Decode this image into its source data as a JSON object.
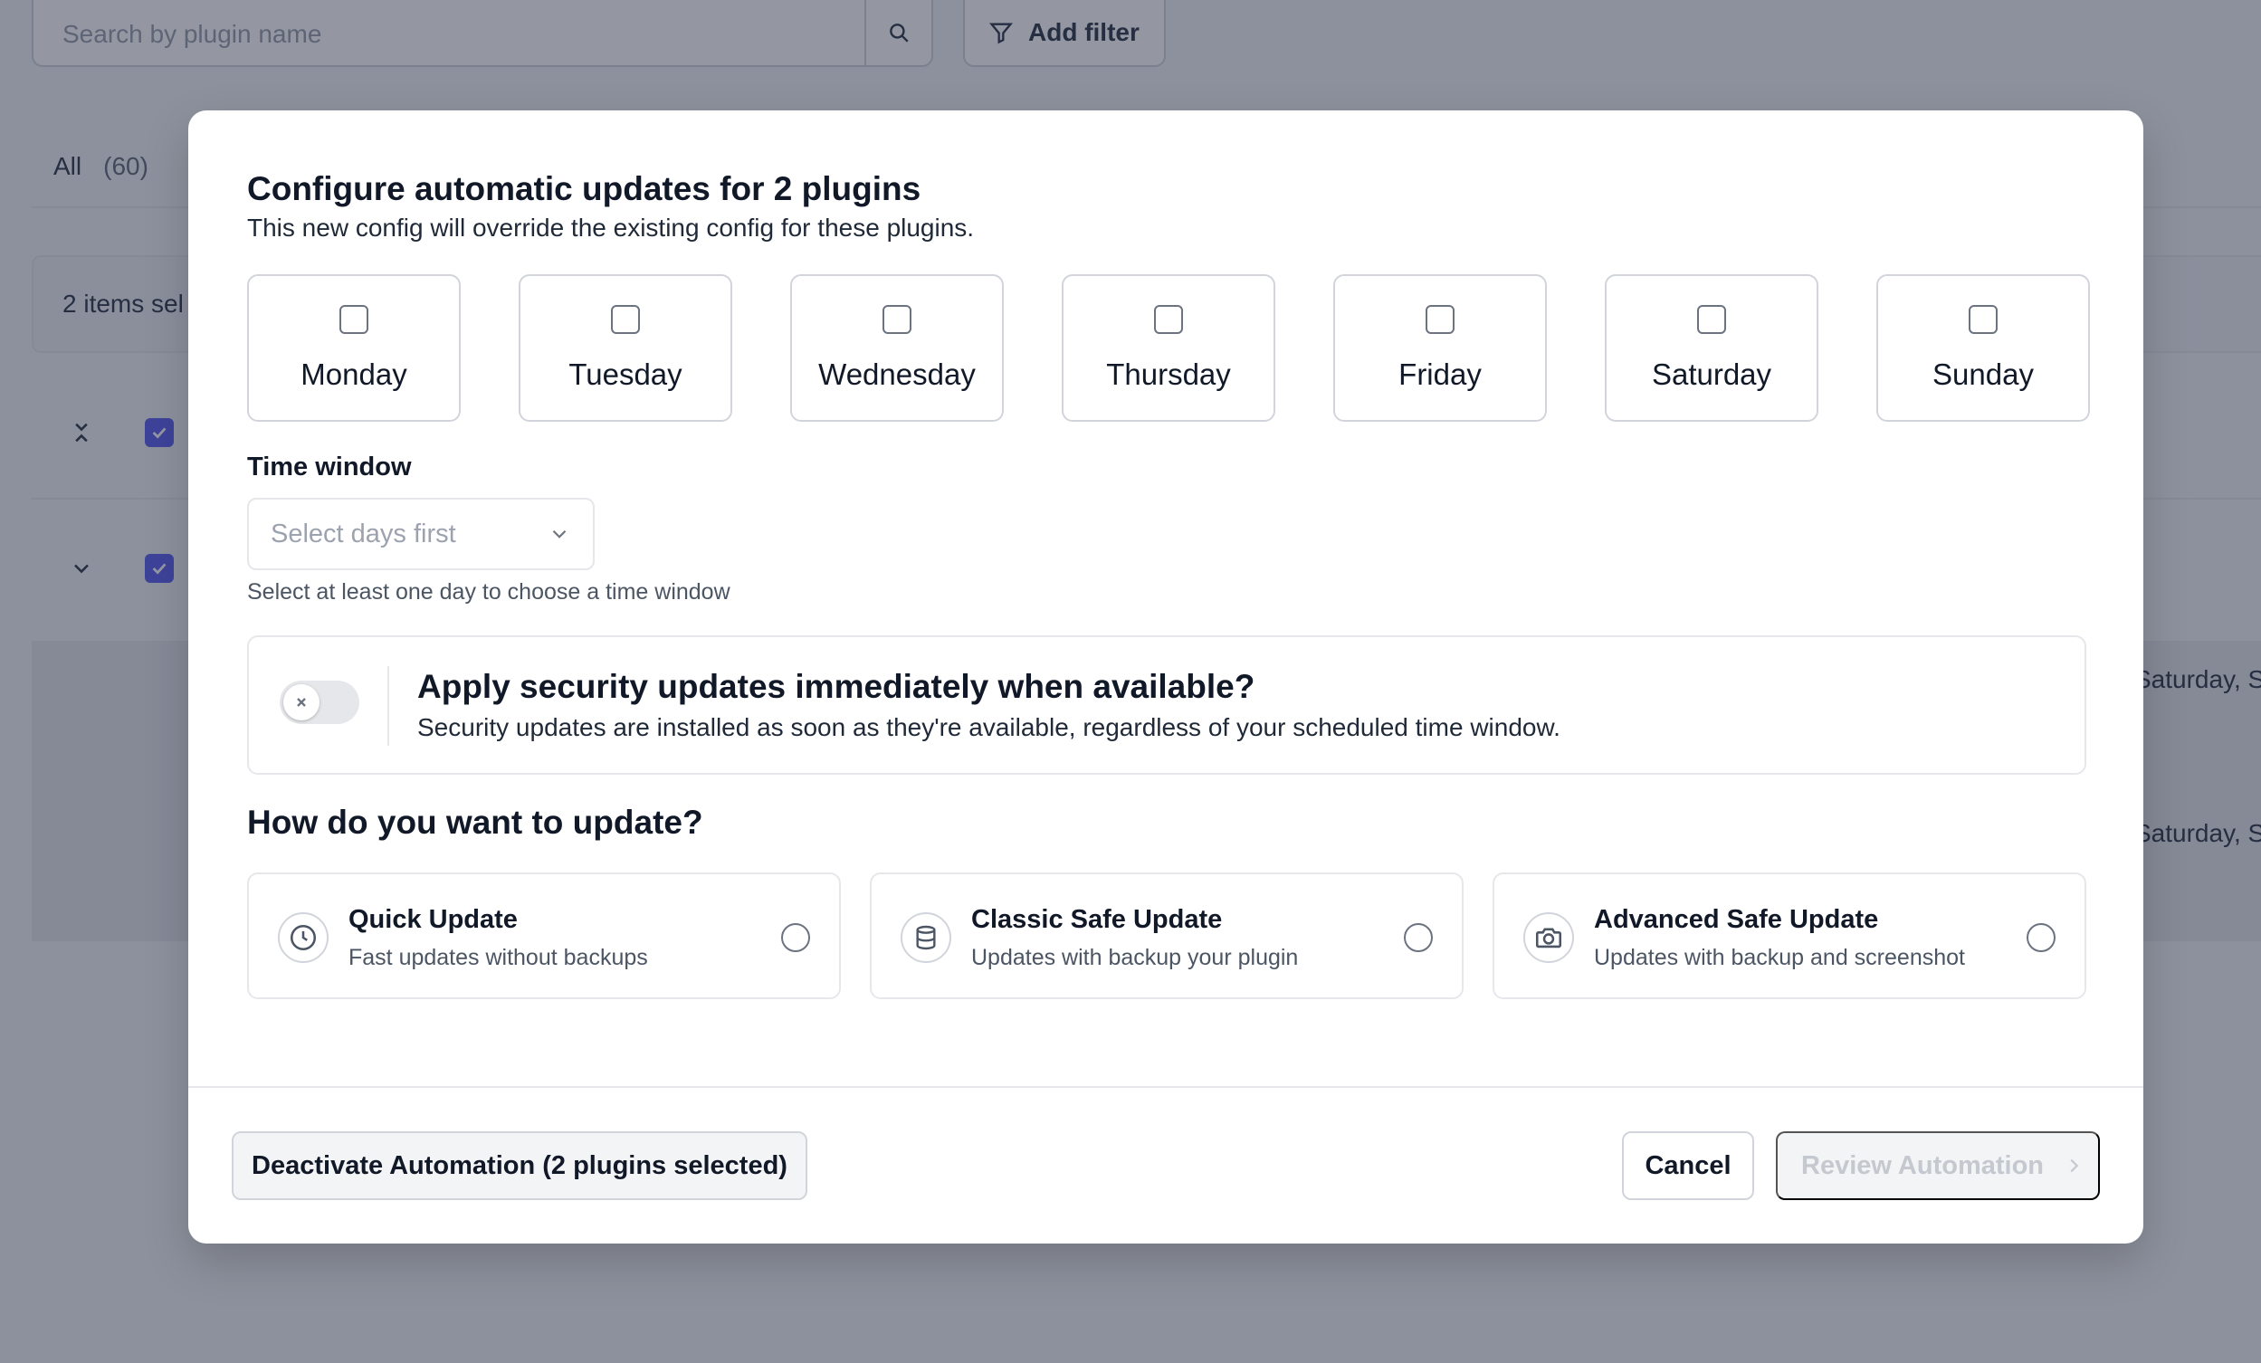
{
  "background": {
    "search_placeholder": "Search by plugin name",
    "add_filter_label": "Add filter",
    "tab_all_label": "All",
    "tab_all_count": "(60)",
    "selected_text": "2 items sel",
    "row_day_text": "Saturday, S"
  },
  "modal": {
    "title": "Configure automatic updates for 2 plugins",
    "subtitle": "This new config will override the existing config for these plugins.",
    "days": [
      "Monday",
      "Tuesday",
      "Wednesday",
      "Thursday",
      "Friday",
      "Saturday",
      "Sunday"
    ],
    "time_window": {
      "label": "Time window",
      "placeholder": "Select days first",
      "hint": "Select at least one day to choose a time window"
    },
    "security": {
      "title": "Apply security updates immediately when available?",
      "description": "Security updates are installed as soon as they're available, regardless of your scheduled time window.",
      "enabled": false
    },
    "how": {
      "title": "How do you want to update?",
      "options": [
        {
          "title": "Quick Update",
          "description": "Fast updates without backups",
          "icon": "clock-icon"
        },
        {
          "title": "Classic Safe Update",
          "description": "Updates with backup your plugin",
          "icon": "database-icon"
        },
        {
          "title": "Advanced Safe Update",
          "description": "Updates with backup and screenshot",
          "icon": "camera-icon"
        }
      ]
    },
    "footer": {
      "deactivate_label": "Deactivate Automation (2 plugins selected)",
      "cancel_label": "Cancel",
      "review_label": "Review Automation"
    }
  },
  "colors": {
    "accent": "#6366f1",
    "overlay": "#111831",
    "border": "#e5e7eb",
    "disabled_text": "#c4c8cf"
  }
}
